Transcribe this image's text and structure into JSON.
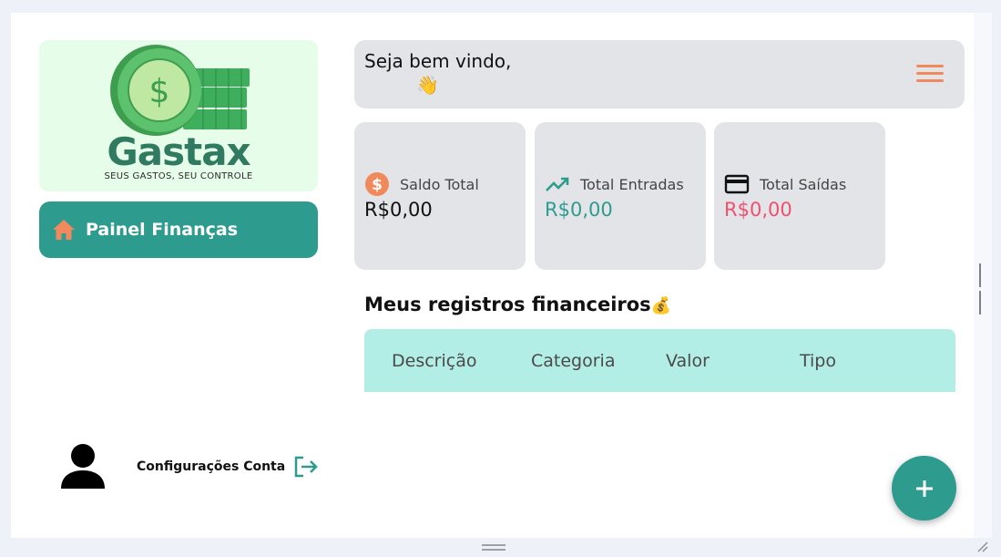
{
  "sidebar": {
    "logo": {
      "title": "Gastax",
      "tagline": "SEUS GASTOS, SEU CONTROLE",
      "coin_symbol": "$"
    },
    "nav_active": {
      "label": "Painel Finanças",
      "icon": "home-icon"
    },
    "account": {
      "label": "Configurações Conta",
      "icon": "user-icon",
      "action_icon": "logout-icon"
    }
  },
  "header": {
    "greeting": "Seja bem vindo,",
    "username": "",
    "wave": "👋",
    "menu_icon": "hamburger-menu-icon"
  },
  "cards": [
    {
      "label": "Saldo Total",
      "value": "R$0,00",
      "icon": "dollar-coin-icon",
      "value_color": "#111111"
    },
    {
      "label": "Total Entradas",
      "value": "R$0,00",
      "icon": "trending-up-icon",
      "value_color": "#2e9b8f"
    },
    {
      "label": "Total Saídas",
      "value": "R$0,00",
      "icon": "credit-card-icon",
      "value_color": "#f0506e"
    }
  ],
  "records": {
    "title": "Meus registros financeiros",
    "title_emoji": "💰",
    "columns": [
      "Descrição",
      "Categoria",
      "Valor",
      "Tipo"
    ],
    "rows": []
  },
  "fab": {
    "label": "+"
  },
  "colors": {
    "primary": "#2e9b8f",
    "accent": "#f08a5d",
    "negative": "#f0506e",
    "card_bg": "#e2e4e8",
    "table_head": "#b2ede6"
  }
}
